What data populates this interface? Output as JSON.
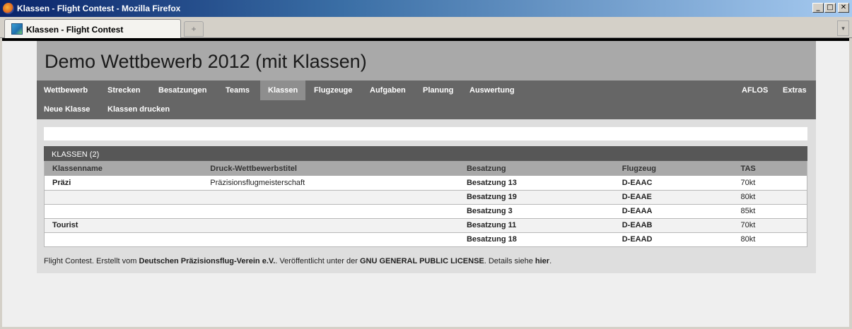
{
  "window": {
    "title": "Klassen - Flight Contest - Mozilla Firefox",
    "min_glyph": "_",
    "max_glyph": "□",
    "close_glyph": "✕"
  },
  "browser": {
    "tab_label": "Klassen - Flight Contest",
    "new_tab_glyph": "+",
    "tab_list_glyph": "▾"
  },
  "site": {
    "title": "Demo Wettbewerb 2012 (mit Klassen)"
  },
  "nav": {
    "main": [
      "Wettbewerb",
      "Strecken",
      "Besatzungen",
      "Teams",
      "Klassen",
      "Flugzeuge",
      "Aufgaben",
      "Planung",
      "Auswertung"
    ],
    "right": [
      "AFLOS",
      "Extras"
    ],
    "sub": [
      "Neue Klasse",
      "Klassen drucken"
    ],
    "active": "Klassen"
  },
  "panel": {
    "title": "KLASSEN (2)",
    "columns": [
      "Klassenname",
      "Druck-Wettbewerbstitel",
      "Besatzung",
      "Flugzeug",
      "TAS"
    ],
    "rows": [
      [
        "Präzi",
        "Präzisionsflugmeisterschaft",
        "Besatzung 13",
        "D-EAAC",
        "70kt"
      ],
      [
        "",
        "",
        "Besatzung 19",
        "D-EAAE",
        "80kt"
      ],
      [
        "",
        "",
        "Besatzung 3",
        "D-EAAA",
        "85kt"
      ],
      [
        "Tourist",
        "",
        "Besatzung 11",
        "D-EAAB",
        "70kt"
      ],
      [
        "",
        "",
        "Besatzung 18",
        "D-EAAD",
        "80kt"
      ]
    ]
  },
  "footer": {
    "t1": "Flight Contest. Erstellt vom ",
    "org": "Deutschen Präzisionsflug-Verein e.V.",
    "t2": ". Veröffentlicht unter der ",
    "license": "GNU GENERAL PUBLIC LICENSE",
    "t3": ". Details siehe ",
    "link": "hier",
    "t4": "."
  }
}
